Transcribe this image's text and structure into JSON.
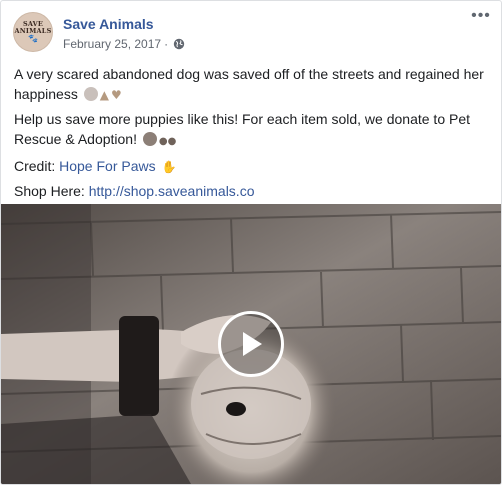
{
  "post": {
    "page_name": "Save Animals",
    "date": "February 25, 2017",
    "meta_separator": "·",
    "avatar_text_line1": "SAVE",
    "avatar_text_line2": "ANIMALS",
    "more_glyph": "•••",
    "paragraph1": "A very scared abandoned dog was saved off of the streets and regained her happiness",
    "paragraph2": "Help us save more puppies like this! For each item sold, we donate to Pet Rescue & Adoption!",
    "credit_label": "Credit:",
    "credit_link": "Hope For Paws",
    "shop_label": "Shop Here:",
    "shop_link": "http://shop.saveanimals.co"
  },
  "icons": [
    "globe-icon",
    "more-options-icon",
    "play-icon",
    "sad-face-emoji",
    "praying-hands-emoji",
    "heart-emoji",
    "dog-face-emoji",
    "paw-prints-emoji",
    "raised-hands-emoji"
  ],
  "colors": {
    "link": "#365899",
    "text": "#1c1e21",
    "meta": "#616770"
  }
}
